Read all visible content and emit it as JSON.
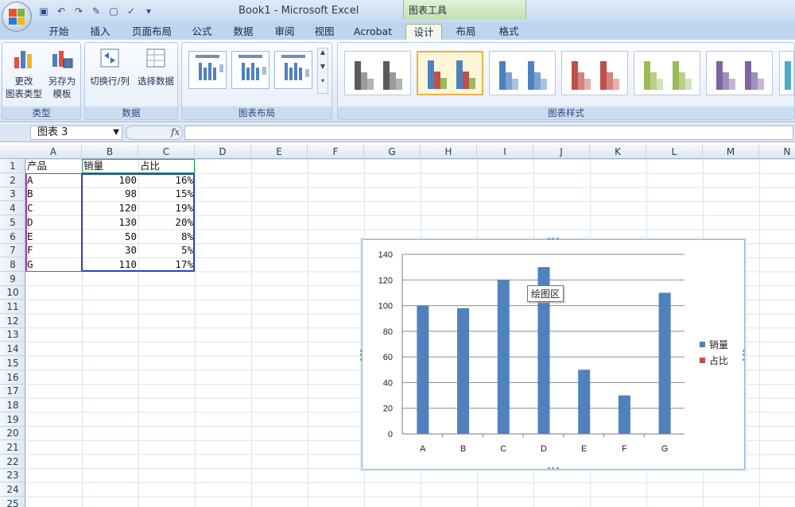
{
  "window": {
    "title": "Book1 - Microsoft Excel",
    "context_tools_label": "图表工具"
  },
  "ribbon": {
    "tabs": [
      {
        "label": "开始",
        "active": false
      },
      {
        "label": "插入",
        "active": false
      },
      {
        "label": "页面布局",
        "active": false
      },
      {
        "label": "公式",
        "active": false
      },
      {
        "label": "数据",
        "active": false
      },
      {
        "label": "审阅",
        "active": false
      },
      {
        "label": "视图",
        "active": false
      },
      {
        "label": "Acrobat",
        "active": false
      },
      {
        "label": "设计",
        "active": true
      },
      {
        "label": "布局",
        "active": false
      },
      {
        "label": "格式",
        "active": false
      }
    ],
    "groups": {
      "type": {
        "label": "类型",
        "change_type": "更改\n图表类型",
        "save_template": "另存为\n模板"
      },
      "data": {
        "label": "数据",
        "switch_row_col": "切换行/列",
        "select_data": "选择数据"
      },
      "layout": {
        "label": "图表布局"
      },
      "styles": {
        "label": "图表样式"
      }
    },
    "style_palettes": [
      [
        "#5a5a5a",
        "#9a9a9a",
        "#b4b4b4"
      ],
      [
        "#4f81bd",
        "#c0504d",
        "#9bbb59"
      ],
      [
        "#4f81bd",
        "#7ea1d2",
        "#a9c2e4"
      ],
      [
        "#c0504d",
        "#d48381",
        "#e5b0ae"
      ],
      [
        "#9bbb59",
        "#b7d08c",
        "#d3e3b6"
      ],
      [
        "#8064a2",
        "#a18fbe",
        "#c4b6d6"
      ]
    ]
  },
  "formula_bar": {
    "name_box": "图表 3",
    "fx": "fx",
    "formula": ""
  },
  "sheet": {
    "columns": [
      "A",
      "B",
      "C",
      "D",
      "E",
      "F",
      "G",
      "H",
      "I",
      "J",
      "K",
      "L",
      "M",
      "N"
    ],
    "rows": [
      "1",
      "2",
      "3",
      "4",
      "5",
      "6",
      "7",
      "8",
      "9",
      "10",
      "11",
      "12",
      "13",
      "14",
      "15",
      "16",
      "17",
      "18",
      "19",
      "20",
      "21",
      "22",
      "23",
      "24",
      "25"
    ],
    "header_row": [
      "产品",
      "销量",
      "占比"
    ],
    "data_rows": [
      [
        "A",
        "100",
        "16%"
      ],
      [
        "B",
        "98",
        "15%"
      ],
      [
        "C",
        "120",
        "19%"
      ],
      [
        "D",
        "130",
        "20%"
      ],
      [
        "E",
        "50",
        "8%"
      ],
      [
        "F",
        "30",
        "5%"
      ],
      [
        "G",
        "110",
        "17%"
      ]
    ]
  },
  "tooltip": "绘图区",
  "chart_data": {
    "type": "bar",
    "categories": [
      "A",
      "B",
      "C",
      "D",
      "E",
      "F",
      "G"
    ],
    "series": [
      {
        "name": "销量",
        "values": [
          100,
          98,
          120,
          130,
          50,
          30,
          110
        ],
        "color": "#4f81bd"
      },
      {
        "name": "占比",
        "values": [
          0.16,
          0.15,
          0.19,
          0.2,
          0.08,
          0.05,
          0.17
        ],
        "color": "#c0504d"
      }
    ],
    "title": "",
    "xlabel": "",
    "ylabel": "",
    "ylim": [
      0,
      140
    ],
    "yticks": [
      0,
      20,
      40,
      60,
      80,
      100,
      120,
      140
    ],
    "grid": true,
    "legend": "right"
  }
}
